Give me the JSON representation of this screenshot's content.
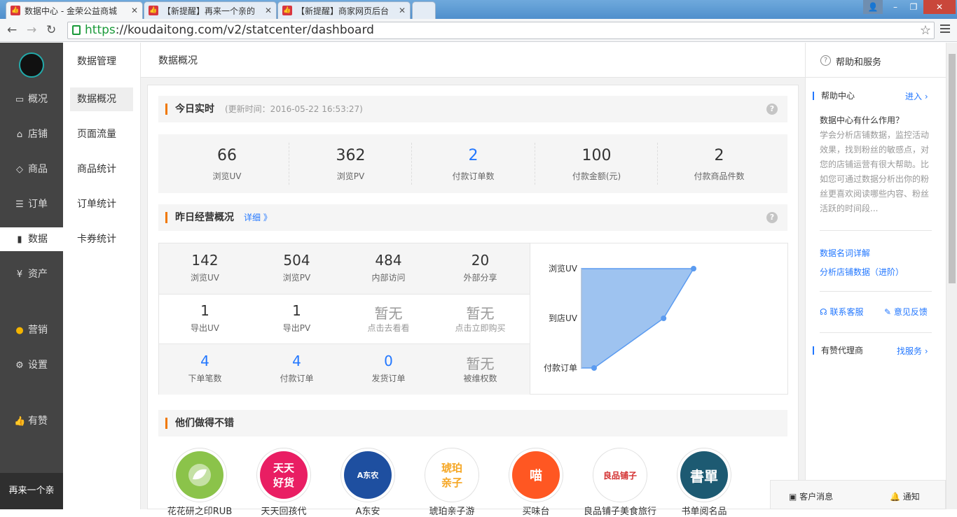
{
  "browser": {
    "tabs": [
      {
        "title": "数据中心 - 金荣公益商城"
      },
      {
        "title": "【新提醒】再来一个亲的"
      },
      {
        "title": "【新提醒】商家网页后台"
      }
    ],
    "url_scheme": "https",
    "url_rest": "://koudaitong.com/v2/statcenter/dashboard"
  },
  "sidebar": {
    "items": [
      {
        "label": "概况",
        "icon": "monitor-icon"
      },
      {
        "label": "店铺",
        "icon": "store-icon"
      },
      {
        "label": "商品",
        "icon": "tag-icon"
      },
      {
        "label": "订单",
        "icon": "list-icon"
      },
      {
        "label": "数据",
        "icon": "bar-chart-icon"
      },
      {
        "label": "资产",
        "icon": "yen-icon"
      },
      {
        "label": "营销",
        "icon": "apps-icon"
      },
      {
        "label": "设置",
        "icon": "gear-icon"
      },
      {
        "label": "有赞",
        "icon": "thumb-icon"
      }
    ],
    "store_name": "再来一个亲"
  },
  "subnav": {
    "title": "数据管理",
    "items": [
      "数据概况",
      "页面流量",
      "商品统计",
      "订单统计",
      "卡券统计"
    ]
  },
  "topbar": {
    "title": "数据概况"
  },
  "today": {
    "title": "今日实时",
    "updated": "(更新时间：2016-05-22 16:53:27)",
    "stats": [
      {
        "value": "66",
        "label": "浏览UV"
      },
      {
        "value": "362",
        "label": "浏览PV"
      },
      {
        "value": "2",
        "label": "付款订单数"
      },
      {
        "value": "100",
        "label": "付款金额(元)"
      },
      {
        "value": "2",
        "label": "付款商品件数"
      }
    ]
  },
  "yesterday": {
    "title": "昨日经营概况",
    "detail_link": "详细 》",
    "cells": [
      {
        "value": "142",
        "label": "浏览UV"
      },
      {
        "value": "504",
        "label": "浏览PV"
      },
      {
        "value": "484",
        "label": "内部访问"
      },
      {
        "value": "20",
        "label": "外部分享"
      },
      {
        "value": "1",
        "label": "导出UV"
      },
      {
        "value": "1",
        "label": "导出PV"
      },
      {
        "value": "暂无",
        "label": "点击去看看"
      },
      {
        "value": "暂无",
        "label": "点击立即购买"
      },
      {
        "value": "4",
        "label": "下单笔数"
      },
      {
        "value": "4",
        "label": "付款订单"
      },
      {
        "value": "0",
        "label": "发货订单"
      },
      {
        "value": "暂无",
        "label": "被维权数"
      }
    ]
  },
  "chart_data": {
    "type": "area",
    "categories": [
      "浏览UV",
      "到店UV",
      "付款订单"
    ],
    "values": [
      142,
      116,
      4
    ],
    "color": "#9ec3f0"
  },
  "others": {
    "title": "他们做得不错",
    "shops": [
      {
        "name": "花花研之印RUB",
        "color": "#8bc34a",
        "logo_text": ""
      },
      {
        "name": "天天回孩代",
        "color": "#e91e63",
        "logo_text": "天天\n好货"
      },
      {
        "name": "A东安",
        "color": "#1e4fa0",
        "logo_text": "A东农"
      },
      {
        "name": "琥珀亲子游",
        "color": "#ffffff",
        "logo_text": "琥珀\n亲子"
      },
      {
        "name": "买味台",
        "color": "#ff5722",
        "logo_text": "喵"
      },
      {
        "name": "良品铺子美食旅行",
        "color": "#ffffff",
        "logo_text": "良品铺子"
      },
      {
        "name": "书单阅名品",
        "color": "#1d5a72",
        "logo_text": "書單"
      }
    ]
  },
  "right": {
    "title": "帮助和服务",
    "help_center": "帮助中心",
    "enter": "进入 ›",
    "q": "数据中心有什么作用？",
    "desc": "学会分析店铺数据，监控活动效果，找到粉丝的敏感点，对您的店铺运营有很大帮助。比如您可通过数据分析出你的粉丝更喜欢阅读哪些内容、粉丝活跃的时间段...",
    "link1": "数据名词详解",
    "link2": "分析店铺数据（进阶）",
    "contact": "联系客服",
    "feedback": "意见反馈",
    "agent": "有赞代理商",
    "find_service": "找服务 ›"
  },
  "msgbar": {
    "messages": "客户消息",
    "notify": "通知"
  }
}
